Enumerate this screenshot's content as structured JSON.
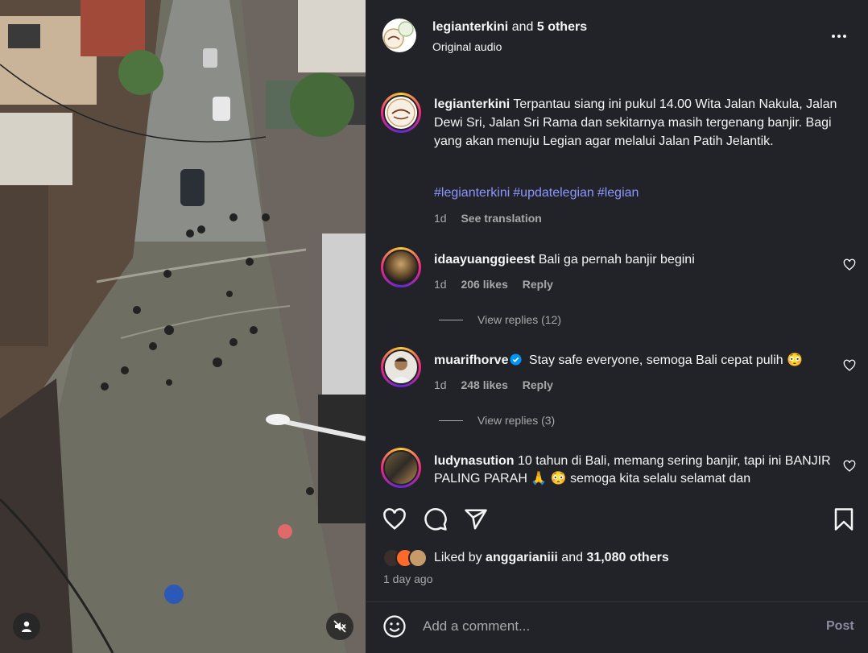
{
  "post": {
    "header": {
      "author": "legianterkini",
      "and_text": " and ",
      "others": "5 others",
      "audio": "Original audio"
    },
    "caption": {
      "username": "legianterkini",
      "text": "Terpantau siang ini pukul 14.00 Wita Jalan Nakula, Jalan Dewi Sri, Jalan Sri Rama dan sekitarnya masih tergenang banjir. Bagi yang akan menuju Legian agar melalui Jalan Patih Jelantik.",
      "hashtags": [
        "#legianterkini",
        "#updatelegian",
        "#legian"
      ],
      "age": "1d",
      "see_translation": "See translation"
    },
    "comments": [
      {
        "username": "idaayuanggieest",
        "text": "Bali ga pernah banjir begini",
        "age": "1d",
        "likes": "206 likes",
        "reply": "Reply",
        "view_replies": "View replies (12)"
      },
      {
        "username": "muarifhorve",
        "text": "Stay safe everyone, semoga Bali cepat pulih 😳",
        "age": "1d",
        "likes": "248 likes",
        "reply": "Reply",
        "view_replies": "View replies (3)"
      },
      {
        "username": "ludynasution",
        "text": "10 tahun di Bali, memang sering banjir, tapi ini BANJIR PALING PARAH 🙏 😳 semoga kita selalu selamat dan"
      }
    ],
    "likes": {
      "prefix": "Liked by ",
      "user": "anggarianiii",
      "mid": " and ",
      "count": "31,080 others"
    },
    "timestamp": "1 day ago",
    "comment_input": {
      "placeholder": "Add a comment...",
      "post_label": "Post"
    }
  },
  "icons": {
    "more": "more-horizontal-icon",
    "heart": "heart-icon",
    "comment": "comment-icon",
    "share": "share-icon",
    "save": "bookmark-icon",
    "emoji": "emoji-icon",
    "user": "user-tag-icon",
    "mute": "speaker-muted-icon"
  },
  "colors": {
    "panel_bg": "#212328",
    "hashtag": "#8c96ff",
    "secondary_text": "#a8a8a8",
    "verified": "#0095f6"
  }
}
